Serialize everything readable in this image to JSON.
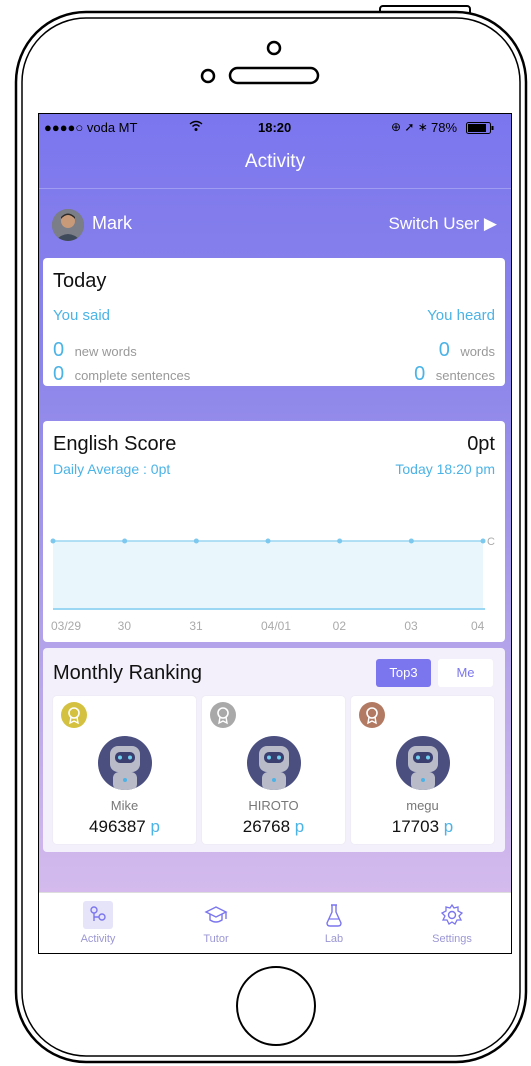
{
  "status_bar": {
    "carrier": "●●●●○ voda MT",
    "time": "18:20",
    "battery": "78%"
  },
  "header": {
    "title": "Activity"
  },
  "user": {
    "name": "Mark",
    "switch_label": "Switch User ▶"
  },
  "today": {
    "title": "Today",
    "said_label": "You said",
    "heard_label": "You heard",
    "said_words_value": "0",
    "said_words_label": "new words",
    "heard_words_value": "0",
    "heard_words_label": "words",
    "said_sentences_value": "0",
    "said_sentences_label": "complete sentences",
    "heard_sentences_value": "0",
    "heard_sentences_label": "sentences"
  },
  "score": {
    "title": "English Score",
    "value": "0pt",
    "daily_average": "Daily Average : 0pt",
    "timestamp": "Today 18:20 pm",
    "edge_label": "C"
  },
  "chart_data": {
    "type": "area",
    "categories": [
      "03/29",
      "30",
      "31",
      "04/01",
      "02",
      "03",
      "04"
    ],
    "values": [
      0,
      0,
      0,
      0,
      0,
      0,
      0
    ]
  },
  "ranking": {
    "title": "Monthly Ranking",
    "tabs": [
      {
        "label": "Top3",
        "active": true
      },
      {
        "label": "Me",
        "active": false
      }
    ],
    "entries": [
      {
        "name": "Mike",
        "score": "496387",
        "unit": "p",
        "medal": "gold-medal-icon",
        "medal_color": "#d3c13f"
      },
      {
        "name": "HIROTO",
        "score": "26768",
        "unit": "p",
        "medal": "silver-medal-icon",
        "medal_color": "#a9a9a9"
      },
      {
        "name": "megu",
        "score": "17703",
        "unit": "p",
        "medal": "bronze-medal-icon",
        "medal_color": "#b27a63"
      }
    ]
  },
  "tabbar": {
    "items": [
      {
        "label": "Activity",
        "icon": "activity-icon",
        "active": true
      },
      {
        "label": "Tutor",
        "icon": "graduation-cap-icon",
        "active": false
      },
      {
        "label": "Lab",
        "icon": "flask-icon",
        "active": false
      },
      {
        "label": "Settings",
        "icon": "gear-icon",
        "active": false
      }
    ]
  },
  "colors": {
    "accent": "#7b76ee",
    "value_blue": "#4bb3e6",
    "tab_label": "#9b97d4"
  }
}
